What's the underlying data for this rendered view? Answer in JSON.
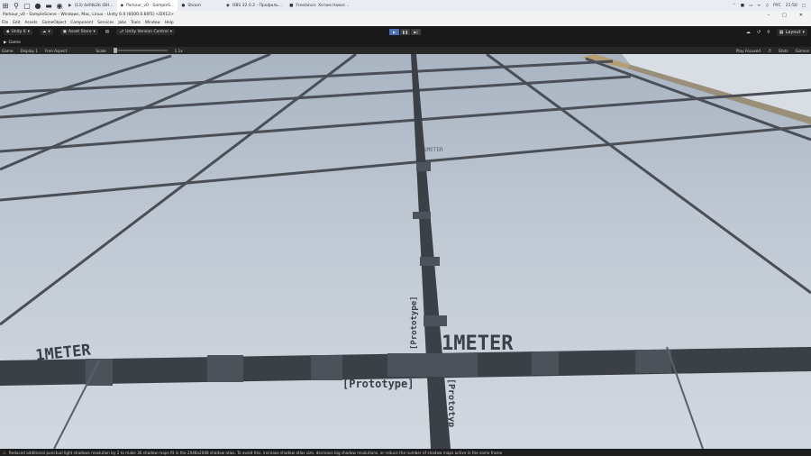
{
  "taskbar": {
    "tabs": [
      {
        "label": "(13) 4efdb2b (BH..."
      },
      {
        "label": "Parkour_v0 - SampleS..."
      },
      {
        "label": "Steam"
      },
      {
        "label": "OBS 32.0.2 - Профиль..."
      },
      {
        "label": "Freelance: Хотим Новог..."
      }
    ],
    "lang": "РУС",
    "time": "21:50"
  },
  "window": {
    "title": "Parkour_v0 - SampleScene - Windows, Mac, Linux - Unity 6.0 (6000.0.60f1) <DX12>"
  },
  "menu": {
    "items": [
      "File",
      "Edit",
      "Assets",
      "GameObject",
      "Component",
      "Services",
      "Jobs",
      "Tools",
      "Window",
      "Help"
    ]
  },
  "toolbar": {
    "account": "Unity 6",
    "cloud": "☰",
    "asset_store": "Asset Store",
    "version_control": "Unity Version Control",
    "layout": "Layout"
  },
  "tabs": {
    "game": "Game"
  },
  "game_controls": {
    "mode": "Game",
    "display": "Display 1",
    "aspect": "Free Aspect",
    "scale_label": "Scale",
    "scale_value": "1.1x",
    "play_focused": "Play Focused",
    "stats": "Stats",
    "gizmos": "Gizmos"
  },
  "scene": {
    "meter_main": "1METER",
    "meter_left": "1METER",
    "meter_far": "1METER",
    "prototype_bottom": "[Prototype]",
    "prototype_vertical": "[Prototype]",
    "prototype_right": "[Prototyp"
  },
  "status": {
    "message": "Reduced additional punctual light shadows resolution by 2 to make 36 shadow maps fit in the 2048x2048 shadow atlas. To avoid this, increase shadow atlas size, decrease big shadow resolutions, or reduce the number of shadow maps active in the same frame"
  },
  "colors": {
    "floor_near": "#c9d1dc",
    "floor_far": "#a9b4c2",
    "grid_line": "#3b3f46",
    "accent_play": "#4a6fb5"
  }
}
